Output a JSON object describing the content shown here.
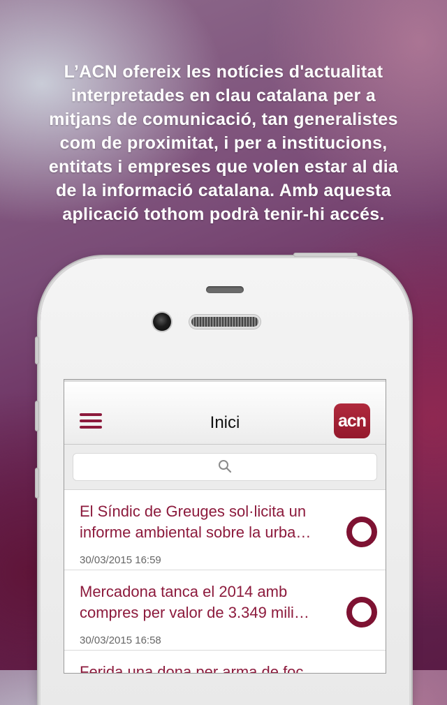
{
  "intro_text": "L’ACN ofereix les notícies d'actualitat interpretades en clau catalana per a mitjans de comunicació, tan generalistes com de proximitat, i per a institucions, entitats i empreses que volen estar al dia de la informació catalana. Amb aquesta aplicació tothom podrà tenir-hi accés.",
  "intro_lines": [
    "L’ACN ofereix les notícies d'actualitat",
    "interpretades en clau catalana per a",
    "mitjans de comunicació, tan generalistes",
    "com de proximitat, i per a institucions,",
    "entitats i empreses que volen estar al dia",
    "de la informació catalana. Amb aquesta",
    "aplicació tothom podrà tenir-hi accés."
  ],
  "navbar": {
    "title": "Inici",
    "logo_text": "acn",
    "menu_icon": "hamburger-icon"
  },
  "search": {
    "placeholder": "",
    "icon": "search-icon"
  },
  "news": [
    {
      "line1": "El Síndic de Greuges sol·licita un",
      "line2": "informe ambiental sobre la urba…",
      "date": "30/03/2015 16:59"
    },
    {
      "line1": "Mercadona tanca el 2014 amb",
      "line2": "compres per valor de 3.349 mili…",
      "date": "30/03/2015 16:58"
    },
    {
      "line1": "Ferida una dona per arma de foc",
      "line2": "",
      "date": ""
    }
  ],
  "colors": {
    "brand": "#8c1a3c",
    "logo_bg": "#a32036"
  }
}
